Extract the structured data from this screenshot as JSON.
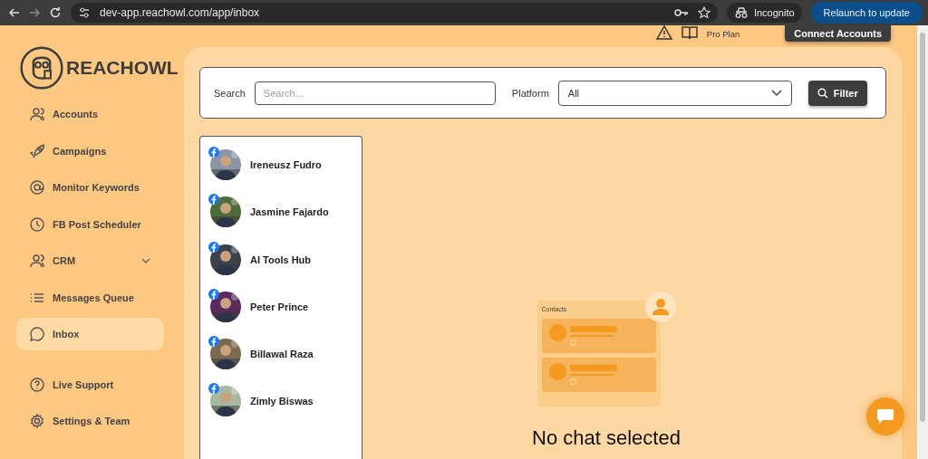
{
  "browser": {
    "url": "dev-app.reachowl.com/app/inbox",
    "profile": "Incognito",
    "update_button": "Relaunch to update"
  },
  "header": {
    "plan": "Pro Plan",
    "connect_button": "Connect Accounts"
  },
  "logo": {
    "text": "REACHOWL"
  },
  "sidebar": {
    "items": [
      {
        "label": "Accounts",
        "kind": "users",
        "selected": false
      },
      {
        "label": "Campaigns",
        "kind": "rocket",
        "selected": false
      },
      {
        "label": "Monitor Keywords",
        "kind": "at",
        "selected": false
      },
      {
        "label": "FB Post Scheduler",
        "kind": "clock",
        "selected": false
      },
      {
        "label": "CRM",
        "kind": "users",
        "selected": false,
        "expandable": true
      },
      {
        "label": "Messages Queue",
        "kind": "list",
        "selected": false
      },
      {
        "label": "Inbox",
        "kind": "chat",
        "selected": true
      },
      {
        "label": "Live Support",
        "kind": "help",
        "selected": false
      },
      {
        "label": "Settings & Team",
        "kind": "gear",
        "selected": false
      }
    ]
  },
  "filters": {
    "search_label": "Search",
    "search_placeholder": "Search...",
    "platform_label": "Platform",
    "platform_value": "All",
    "filter_button": "Filter"
  },
  "contacts": [
    {
      "name": "Ireneusz Fudro",
      "kind": "picture"
    },
    {
      "name": "Jasmine Fajardo",
      "kind": "picture"
    },
    {
      "name": "AI Tools Hub",
      "kind": "picture"
    },
    {
      "name": "Peter Prince",
      "kind": "picture"
    },
    {
      "name": "Billawal Raza",
      "kind": "picture"
    },
    {
      "name": "Zimly Biswas",
      "kind": "picture"
    }
  ],
  "empty_state": {
    "illustration_title": "Contacts",
    "message": "No chat selected"
  }
}
